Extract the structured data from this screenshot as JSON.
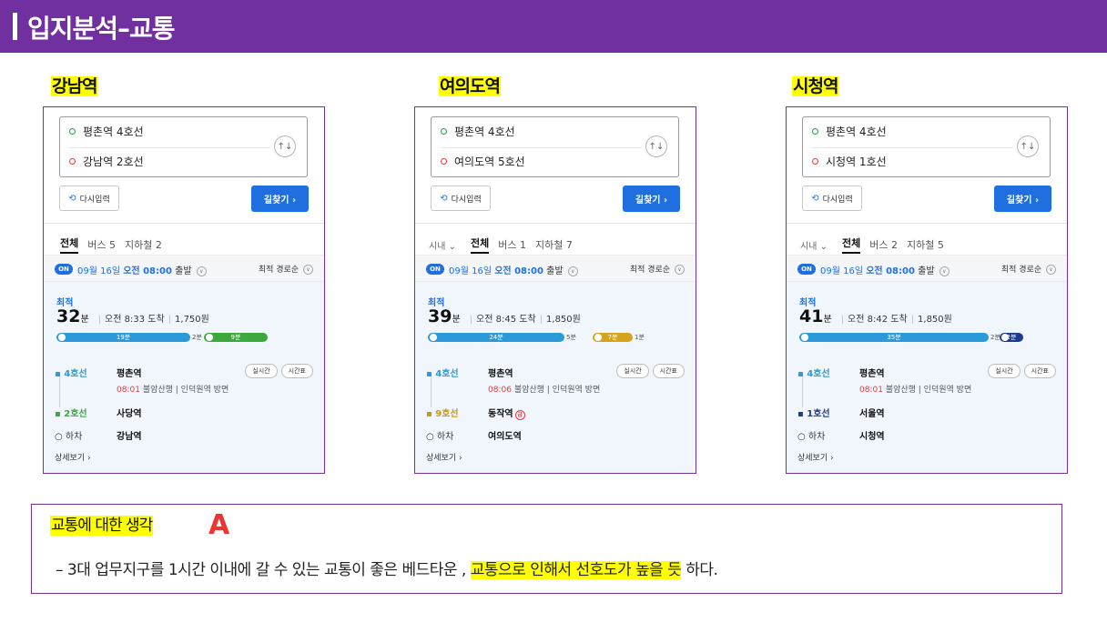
{
  "header": {
    "title": "입지분석–교통"
  },
  "panels": [
    {
      "station_label": "강남역",
      "origin": "평촌역 4호선",
      "destination": "강남역 2호선",
      "reset_label": "다시입력",
      "search_label": "길찾기 ›",
      "city_filter": "",
      "tabs": {
        "all": "전체",
        "bus": "버스 5",
        "subway": "지하철 2"
      },
      "on_label": "ON",
      "depart_date": "09월 16일",
      "depart_time": "오전 08:00",
      "depart_suffix": "출발",
      "sort_label": "최적 경로순",
      "best_label": "최적",
      "total_minutes": "32",
      "minute_unit": "분",
      "arrival": "오전 8:33 도착",
      "fare": "1,750원",
      "segments": [
        {
          "label": "19분",
          "minutes": 19,
          "color": "#2a9ad8",
          "kind": "ride"
        },
        {
          "label": "2분",
          "minutes": 2,
          "kind": "walk"
        },
        {
          "label": "9분",
          "minutes": 9,
          "color": "#3ba93b",
          "kind": "ride"
        }
      ],
      "leg1": {
        "line": "4호선",
        "station": "평촌역",
        "time": "08:01",
        "detail": "불암산행 | 인덕원역 방면",
        "line_color": "#2a9ad8"
      },
      "leg2": {
        "line": "2호선",
        "station": "사당역",
        "line_color": "#3ba93b",
        "express": ""
      },
      "realtime_label": "실시간",
      "timetable_label": "시간표",
      "exit": {
        "label": "하차",
        "station": "강남역"
      },
      "more_label": "상세보기 ›"
    },
    {
      "station_label": "여의도역",
      "origin": "평촌역 4호선",
      "destination": "여의도역 5호선",
      "reset_label": "다시입력",
      "search_label": "길찾기 ›",
      "city_filter": "시내 ⌄",
      "tabs": {
        "all": "전체",
        "bus": "버스 1",
        "subway": "지하철 7"
      },
      "on_label": "ON",
      "depart_date": "09월 16일",
      "depart_time": "오전 08:00",
      "depart_suffix": "출발",
      "sort_label": "최적 경로순",
      "best_label": "최적",
      "total_minutes": "39",
      "minute_unit": "분",
      "arrival": "오전 8:45 도착",
      "fare": "1,850원",
      "segments": [
        {
          "label": "24분",
          "minutes": 24,
          "color": "#2a9ad8",
          "kind": "ride"
        },
        {
          "label": "5분",
          "minutes": 5,
          "kind": "walk"
        },
        {
          "label": "7분",
          "minutes": 7,
          "color": "#d4a41d",
          "kind": "ride"
        },
        {
          "label": "1분",
          "minutes": 1,
          "kind": "walk"
        }
      ],
      "leg1": {
        "line": "4호선",
        "station": "평촌역",
        "time": "08:06",
        "detail": "불암산행 | 인덕원역 방면",
        "line_color": "#2a9ad8"
      },
      "leg2": {
        "line": "9호선",
        "station": "동작역",
        "line_color": "#c9960f",
        "express": "급"
      },
      "realtime_label": "실시간",
      "timetable_label": "시간표",
      "exit": {
        "label": "하차",
        "station": "여의도역"
      },
      "more_label": "상세보기 ›"
    },
    {
      "station_label": "시청역",
      "origin": "평촌역 4호선",
      "destination": "시청역 1호선",
      "reset_label": "다시입력",
      "search_label": "길찾기 ›",
      "city_filter": "시내 ⌄",
      "tabs": {
        "all": "전체",
        "bus": "버스 2",
        "subway": "지하철 5"
      },
      "on_label": "ON",
      "depart_date": "09월 16일",
      "depart_time": "오전 08:00",
      "depart_suffix": "출발",
      "sort_label": "최적 경로순",
      "best_label": "최적",
      "total_minutes": "41",
      "minute_unit": "분",
      "arrival": "오전 8:42 도착",
      "fare": "1,850원",
      "segments": [
        {
          "label": "35분",
          "minutes": 35,
          "color": "#2a9ad8",
          "kind": "ride"
        },
        {
          "label": "2분",
          "minutes": 2,
          "kind": "walk"
        },
        {
          "label": "2분",
          "minutes": 2,
          "color": "#1c3c8c",
          "kind": "ride"
        }
      ],
      "leg1": {
        "line": "4호선",
        "station": "평촌역",
        "time": "08:01",
        "detail": "불암산행 | 인덕원역 방면",
        "line_color": "#2a9ad8"
      },
      "leg2": {
        "line": "1호선",
        "station": "서울역",
        "line_color": "#1c3c8c",
        "express": ""
      },
      "realtime_label": "실시간",
      "timetable_label": "시간표",
      "exit": {
        "label": "하차",
        "station": "시청역"
      },
      "more_label": "상세보기 ›"
    }
  ],
  "thoughts": {
    "title": "교통에 대한 생각",
    "grade": "A",
    "text_before": "– 3대 업무지구를 1시간 이내에 갈 수 있는 교통이 좋은 베드타운 ,",
    "text_highlight": "교통으로 인해서 선호도가 높을 듯",
    "text_after": "하다."
  }
}
